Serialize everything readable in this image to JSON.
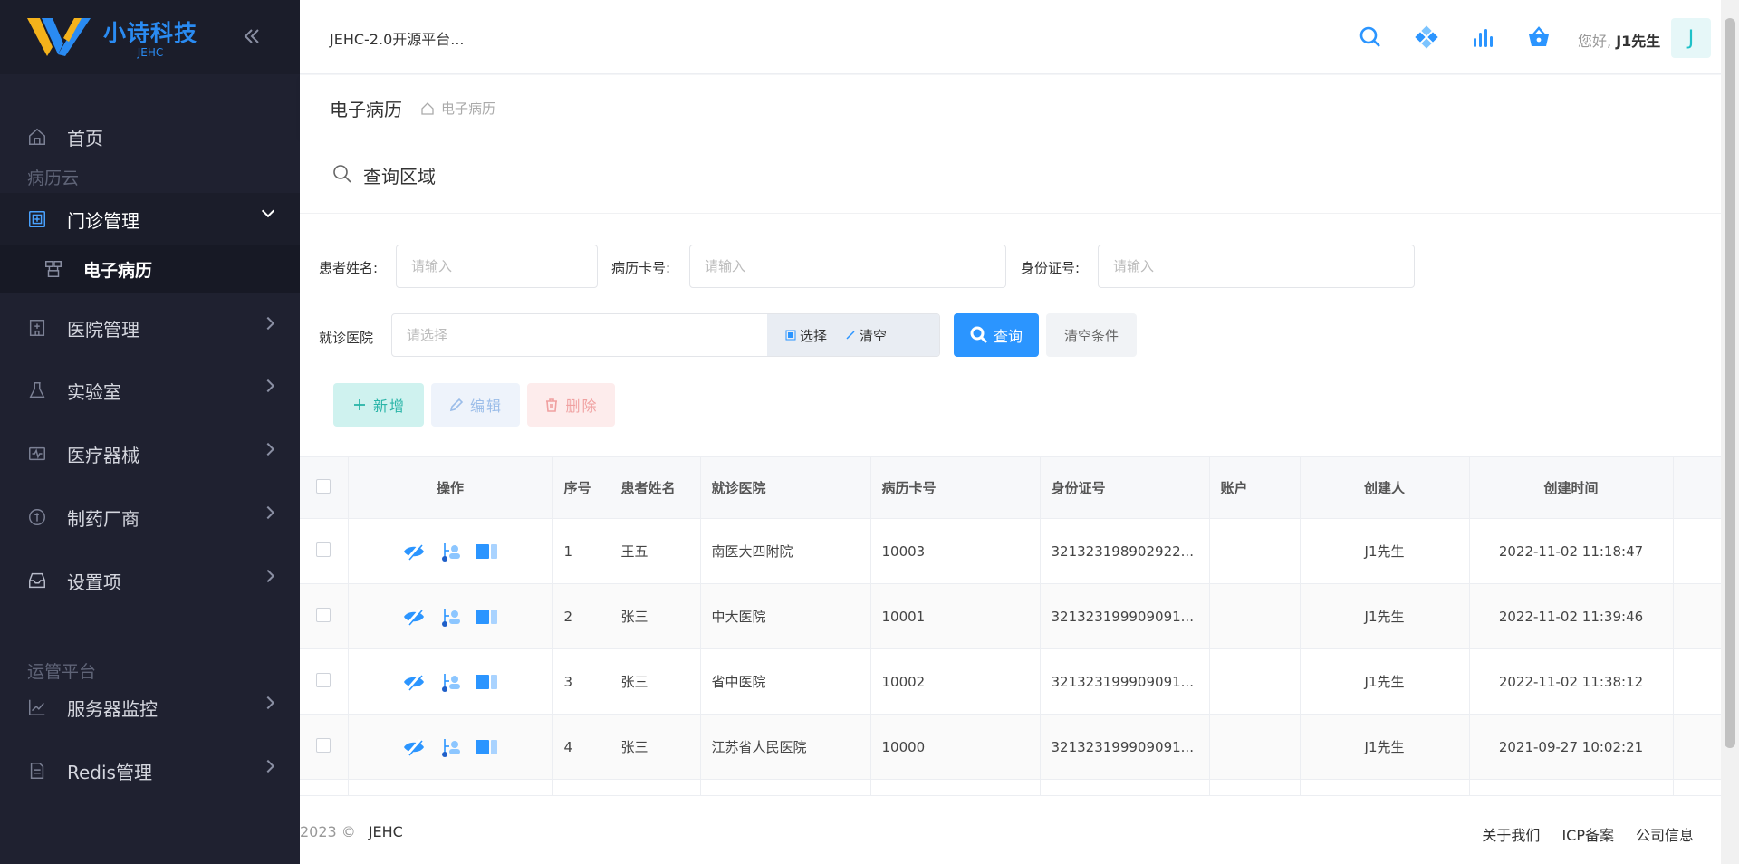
{
  "brand": {
    "name": "小诗科技",
    "sub": "JEHC"
  },
  "header": {
    "platform_title": "JEHC-2.0开源平台...",
    "greeting": "您好,",
    "user_name": "J1先生",
    "avatar_letter": "J"
  },
  "sidebar": {
    "home": "首页",
    "group1": "病历云",
    "outpatient": "门诊管理",
    "emr": "电子病历",
    "hospital": "医院管理",
    "lab": "实验室",
    "device": "医疗器械",
    "pharma": "制药厂商",
    "settings": "设置项",
    "group2": "运管平台",
    "monitor": "服务器监控",
    "redis": "Redis管理"
  },
  "breadcrumb": {
    "title": "电子病历",
    "path": "电子病历"
  },
  "query": {
    "title": "查询区域",
    "patient_label": "患者姓名:",
    "card_label": "病历卡号:",
    "id_label": "身份证号:",
    "hospital_label": "就诊医院",
    "input_placeholder": "请输入",
    "select_placeholder": "请选择",
    "choose": "选择",
    "clear": "清空",
    "search": "查询",
    "reset": "清空条件"
  },
  "actions": {
    "add": "新增",
    "edit": "编辑",
    "delete": "删除"
  },
  "table": {
    "headers": [
      "操作",
      "序号",
      "患者姓名",
      "就诊医院",
      "病历卡号",
      "身份证号",
      "账户",
      "创建人",
      "创建时间"
    ],
    "rows": [
      [
        "1",
        "王五",
        "南医大四附院",
        "10003",
        "321323198902922...",
        "",
        "J1先生",
        "2022-11-02 11:18:47"
      ],
      [
        "2",
        "张三",
        "中大医院",
        "10001",
        "321323199909091...",
        "",
        "J1先生",
        "2022-11-02 11:39:46"
      ],
      [
        "3",
        "张三",
        "省中医院",
        "10002",
        "321323199909091...",
        "",
        "J1先生",
        "2022-11-02 11:38:12"
      ],
      [
        "4",
        "张三",
        "江苏省人民医院",
        "10000",
        "321323199909091...",
        "",
        "J1先生",
        "2021-09-27 10:02:21"
      ]
    ]
  },
  "footer": {
    "copyright": "2023 ©",
    "brand": "JEHC",
    "links": [
      "关于我们",
      "ICP备案",
      "公司信息"
    ]
  },
  "colors": {
    "primary": "#2b95ff",
    "sidebar_bg": "#1f2130",
    "teal": "#2ab5a8",
    "danger": "#f0a0a0"
  }
}
